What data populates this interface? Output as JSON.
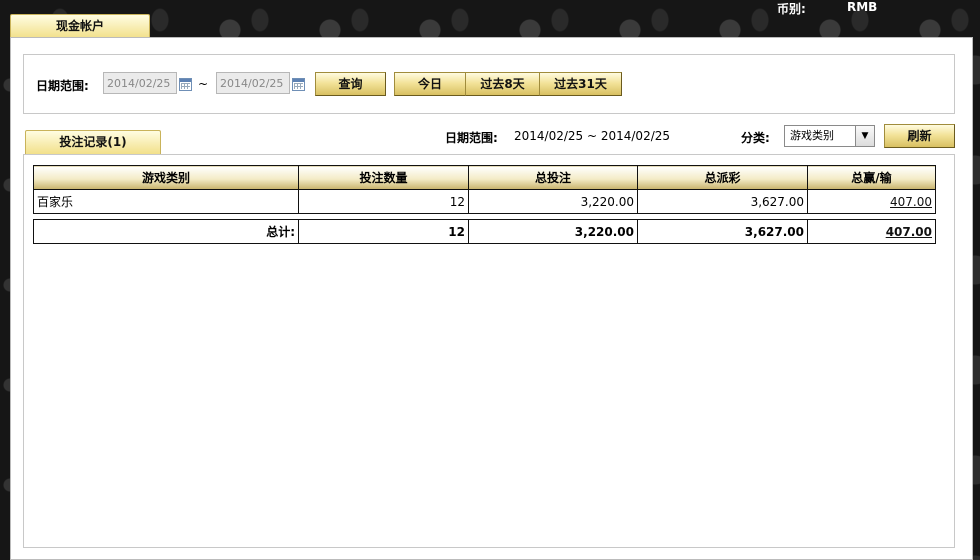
{
  "header": {
    "currency_label": "币别:",
    "currency_value": "RMB"
  },
  "tabs": {
    "cash_account": "现金帐户",
    "records": "投注记录(1)"
  },
  "filter": {
    "date_range_label": "日期范围:",
    "start_date": "2014/02/25",
    "end_date": "2014/02/25",
    "separator": "~",
    "query_button": "查询",
    "today_button": "今日",
    "past8_button": "过去8天",
    "past31_button": "过去31天"
  },
  "info": {
    "date_range_label": "日期范围:",
    "date_range_value": "2014/02/25 ~ 2014/02/25",
    "category_label": "分类:",
    "category_selected": "游戏类别",
    "refresh_button": "刷新"
  },
  "table": {
    "headers": [
      "游戏类别",
      "投注数量",
      "总投注",
      "总派彩",
      "总赢/输"
    ],
    "rows": [
      {
        "game": "百家乐",
        "count": "12",
        "total_bet": "3,220.00",
        "total_payout": "3,627.00",
        "win_loss": "407.00"
      }
    ],
    "totals": {
      "label": "总计:",
      "count": "12",
      "total_bet": "3,220.00",
      "total_payout": "3,627.00",
      "win_loss": "407.00"
    }
  }
}
